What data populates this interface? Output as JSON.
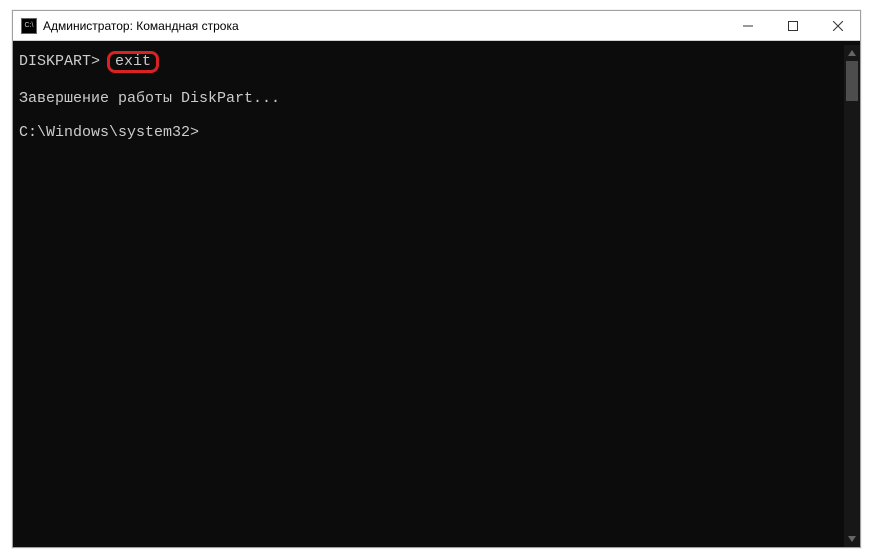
{
  "window": {
    "title": "Администратор: Командная строка",
    "icon_text": "C:\\"
  },
  "terminal": {
    "line1_prompt": "DISKPART>",
    "line1_cmd": "exit",
    "line2": "",
    "line3": "Завершение работы DiskPart...",
    "line4": "",
    "line5_prompt": "C:\\Windows\\system32>",
    "line5_input": ""
  }
}
